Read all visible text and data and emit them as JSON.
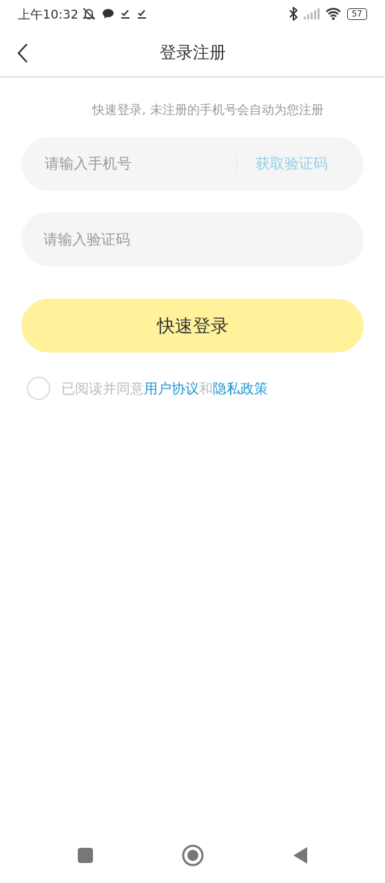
{
  "status_bar": {
    "time": "上午10:32",
    "battery": "57"
  },
  "header": {
    "title": "登录注册"
  },
  "hint": "快速登录, 未注册的手机号会自动为您注册",
  "phone_field": {
    "placeholder": "请输入手机号",
    "action": "获取验证码"
  },
  "code_field": {
    "placeholder": "请输入验证码"
  },
  "login_button": "快速登录",
  "agreement": {
    "checked": false,
    "parts": [
      {
        "kind": "text",
        "text": "已阅读并同意"
      },
      {
        "kind": "link",
        "text": "用户协议"
      },
      {
        "kind": "text",
        "text": "和"
      },
      {
        "kind": "link",
        "text": "隐私政策"
      }
    ]
  }
}
